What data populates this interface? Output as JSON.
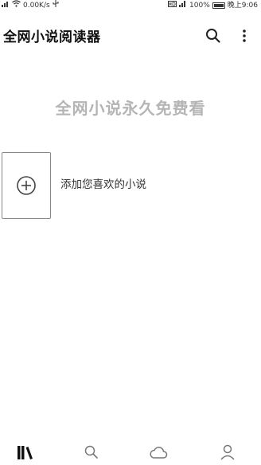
{
  "status_bar": {
    "network_speed": "0.00K/s",
    "battery_percent": "100%",
    "time": "晚上9:06"
  },
  "app_bar": {
    "title": "全网小说阅读器",
    "icons": [
      "search-icon",
      "more-vert-icon"
    ]
  },
  "main": {
    "slogan": "全网小说永久免费看",
    "add_novel_label": "添加您喜欢的小说"
  },
  "bottom_nav": {
    "items": [
      {
        "icon": "bookshelf-icon",
        "active": true
      },
      {
        "icon": "search-icon",
        "active": false
      },
      {
        "icon": "cloud-icon",
        "active": false
      },
      {
        "icon": "profile-icon",
        "active": false
      }
    ]
  },
  "colors": {
    "background": "#ffffff",
    "title_text": "#111111",
    "slogan_text": "#b5b5b5",
    "active_icon": "#111111",
    "inactive_icon": "#777777"
  }
}
